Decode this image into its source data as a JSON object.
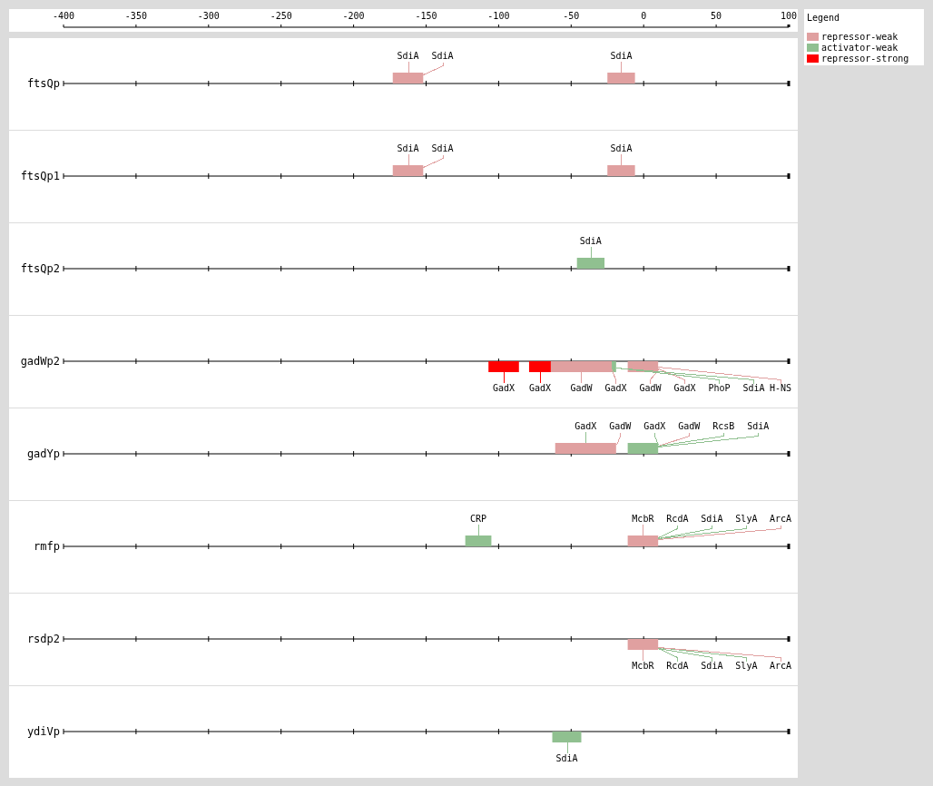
{
  "axis": {
    "xticks": [
      "-400",
      "-350",
      "-300",
      "-250",
      "-200",
      "-150",
      "-100",
      "-50",
      "0",
      "50",
      "100"
    ]
  },
  "legend": {
    "title": "Legend",
    "items": [
      {
        "label": "repressor-weak",
        "color": "#e0a0a0"
      },
      {
        "label": "activator-weak",
        "color": "#90c090"
      },
      {
        "label": "repressor-strong",
        "color": "#ff0000"
      }
    ]
  },
  "promoters": [
    {
      "name": "ftsQp",
      "sites": [
        {
          "label": "SdiA",
          "color": "#e0a0a0"
        },
        {
          "label": "SdiA",
          "color": "#e0a0a0"
        },
        {
          "label": "SdiA",
          "color": "#e0a0a0"
        }
      ]
    },
    {
      "name": "ftsQp1",
      "sites": [
        {
          "label": "SdiA",
          "color": "#e0a0a0"
        },
        {
          "label": "SdiA",
          "color": "#e0a0a0"
        },
        {
          "label": "SdiA",
          "color": "#e0a0a0"
        }
      ]
    },
    {
      "name": "ftsQp2",
      "sites": [
        {
          "label": "SdiA",
          "color": "#90c090"
        }
      ]
    },
    {
      "name": "gadWp2",
      "sites": [
        {
          "label": "GadX",
          "color": "#ff0000"
        },
        {
          "label": "GadX",
          "color": "#ff0000"
        },
        {
          "label": "GadW",
          "color": "#e0a0a0"
        },
        {
          "label": "GadX",
          "color": "#e0a0a0"
        },
        {
          "label": "GadW",
          "color": "#e0a0a0"
        },
        {
          "label": "GadX",
          "color": "#e0a0a0"
        },
        {
          "label": "PhoP",
          "color": "#90c090"
        },
        {
          "label": "SdiA",
          "color": "#90c090"
        },
        {
          "label": "H-NS",
          "color": "#e0a0a0"
        }
      ]
    },
    {
      "name": "gadYp",
      "sites": [
        {
          "label": "GadX",
          "color": "#90c090"
        },
        {
          "label": "GadW",
          "color": "#e0a0a0"
        },
        {
          "label": "GadX",
          "color": "#90c090"
        },
        {
          "label": "GadW",
          "color": "#e0a0a0"
        },
        {
          "label": "RcsB",
          "color": "#90c090"
        },
        {
          "label": "SdiA",
          "color": "#90c090"
        }
      ]
    },
    {
      "name": "rmfp",
      "sites": [
        {
          "label": "CRP",
          "color": "#90c090"
        },
        {
          "label": "McbR",
          "color": "#e0a0a0"
        },
        {
          "label": "RcdA",
          "color": "#90c090"
        },
        {
          "label": "SdiA",
          "color": "#90c090"
        },
        {
          "label": "SlyA",
          "color": "#90c090"
        },
        {
          "label": "ArcA",
          "color": "#e0a0a0"
        }
      ]
    },
    {
      "name": "rsdp2",
      "sites": [
        {
          "label": "McbR",
          "color": "#e0a0a0"
        },
        {
          "label": "RcdA",
          "color": "#90c090"
        },
        {
          "label": "SdiA",
          "color": "#90c090"
        },
        {
          "label": "SlyA",
          "color": "#90c090"
        },
        {
          "label": "ArcA",
          "color": "#e0a0a0"
        }
      ]
    },
    {
      "name": "ydiVp",
      "sites": [
        {
          "label": "SdiA",
          "color": "#90c090"
        }
      ]
    }
  ]
}
